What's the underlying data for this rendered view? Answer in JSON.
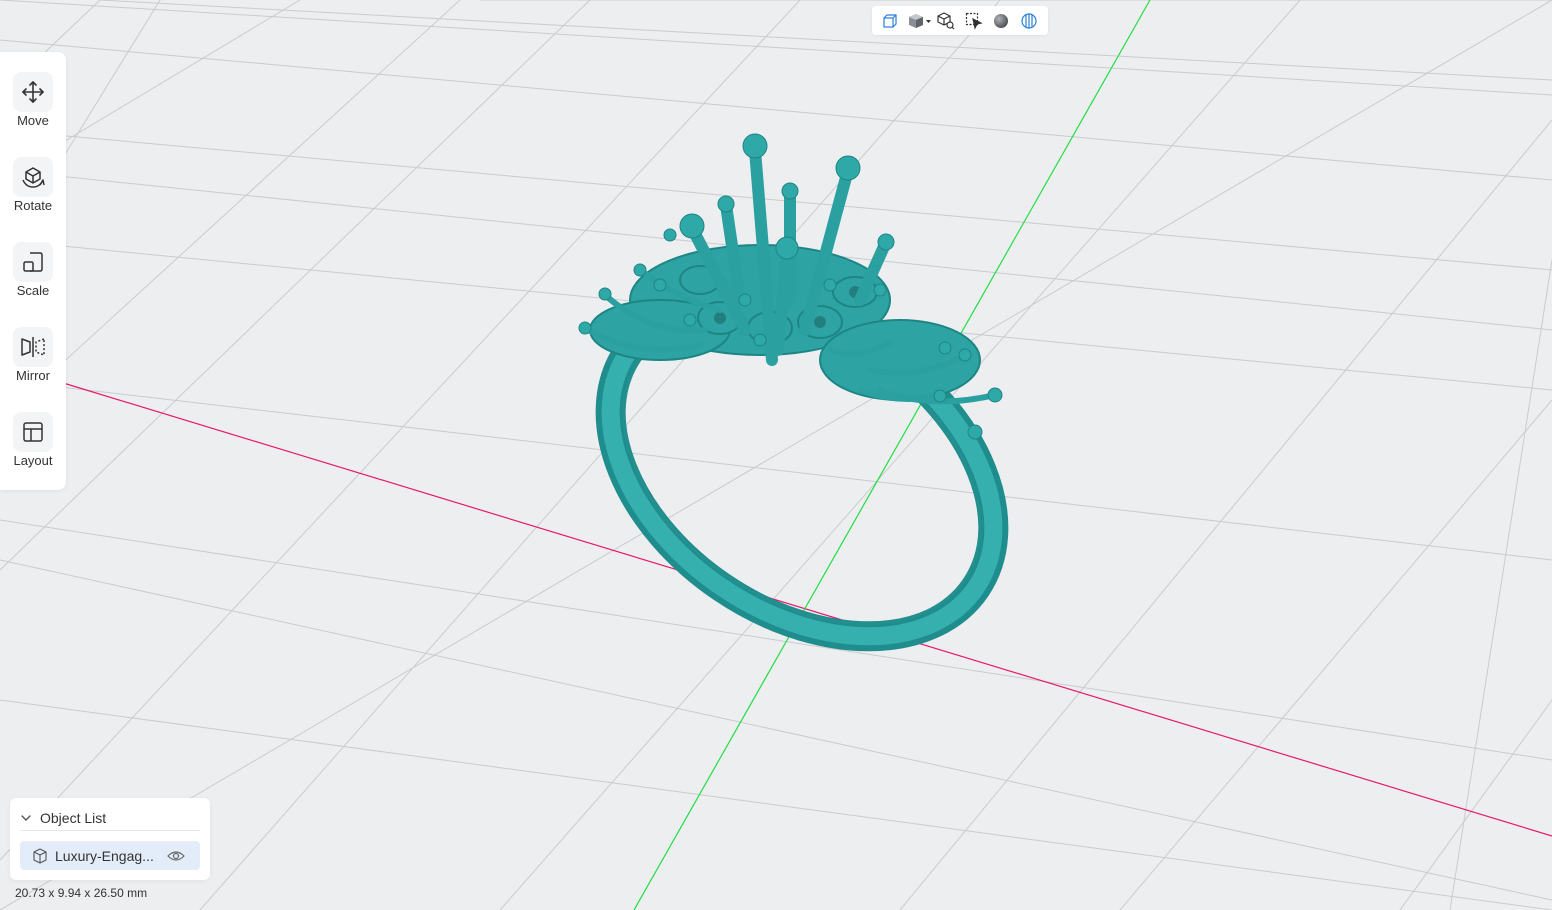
{
  "viewport": {
    "background": "#eceef0",
    "model_color": "#2fa6a6",
    "x_axis_color": "#e8196a",
    "y_axis_color": "#22dd44"
  },
  "left_toolbar": {
    "tools": [
      {
        "label": "Move",
        "icon": "move-icon"
      },
      {
        "label": "Rotate",
        "icon": "rotate-icon"
      },
      {
        "label": "Scale",
        "icon": "scale-icon"
      },
      {
        "label": "Mirror",
        "icon": "mirror-icon"
      },
      {
        "label": "Layout",
        "icon": "layout-icon"
      }
    ]
  },
  "top_toolbar": {
    "buttons": [
      {
        "icon": "perspective-view-icon"
      },
      {
        "icon": "view-cube-dropdown-icon"
      },
      {
        "icon": "zoom-fit-icon"
      },
      {
        "icon": "box-select-icon"
      },
      {
        "icon": "shading-sphere-icon"
      },
      {
        "icon": "xray-icon"
      }
    ]
  },
  "object_list": {
    "title": "Object List",
    "items": [
      {
        "name": "Luxury-Engagement-Ring",
        "display": "Luxury-Engag..."
      }
    ]
  },
  "status": {
    "dimensions": "20.73 x 9.94 x 26.50 mm"
  }
}
